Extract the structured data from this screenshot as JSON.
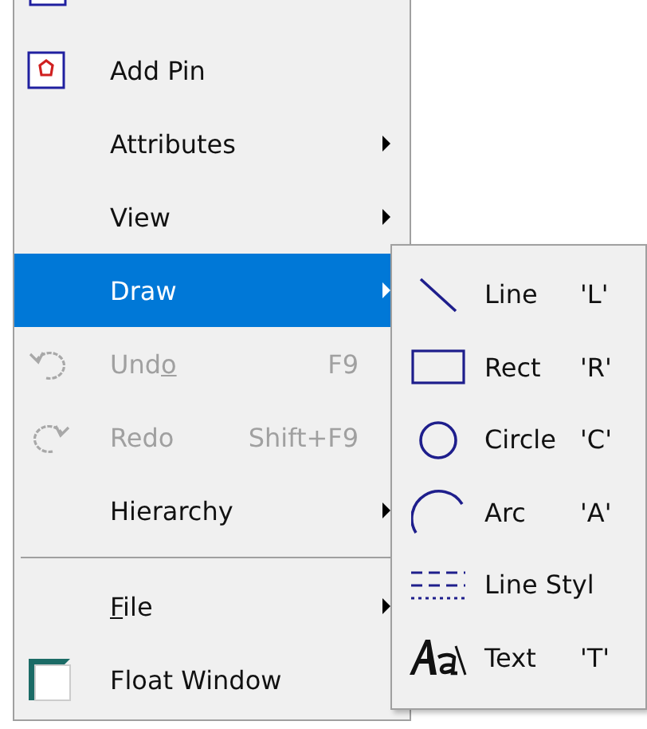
{
  "menu": {
    "items": [
      {
        "kind": "item",
        "label": "Add Pin",
        "submenu": false,
        "disabled": false,
        "selected": false
      },
      {
        "kind": "item",
        "label": "Attributes",
        "submenu": true,
        "disabled": false,
        "selected": false
      },
      {
        "kind": "item",
        "label": "View",
        "submenu": true,
        "disabled": false,
        "selected": false
      },
      {
        "kind": "item",
        "label": "Draw",
        "submenu": true,
        "disabled": false,
        "selected": true
      },
      {
        "kind": "item",
        "label_parts": [
          {
            "text": "Und",
            "underlined": false
          },
          {
            "text": "o",
            "underlined": true
          }
        ],
        "shortcut": "F9",
        "submenu": false,
        "disabled": true,
        "selected": false
      },
      {
        "kind": "item",
        "label": "Redo",
        "shortcut": "Shift+F9",
        "submenu": false,
        "disabled": true,
        "selected": false
      },
      {
        "kind": "item",
        "label": "Hierarchy",
        "submenu": true,
        "disabled": false,
        "selected": false
      },
      {
        "kind": "separator"
      },
      {
        "kind": "item",
        "label_parts": [
          {
            "text": "F",
            "underlined": true
          },
          {
            "text": "ile",
            "underlined": false
          }
        ],
        "submenu": true,
        "disabled": false,
        "selected": false
      },
      {
        "kind": "item",
        "label": "Float Window",
        "submenu": false,
        "disabled": false,
        "selected": false
      }
    ]
  },
  "submenu": {
    "items": [
      {
        "label": "Line",
        "shortcut": "'L'"
      },
      {
        "label": "Rect",
        "shortcut": "'R'"
      },
      {
        "label": "Circle",
        "shortcut": "'C'"
      },
      {
        "label": "Arc",
        "shortcut": "'A'"
      },
      {
        "label": "Line Styl"
      },
      {
        "label": "Text",
        "shortcut": "'T'"
      }
    ]
  }
}
